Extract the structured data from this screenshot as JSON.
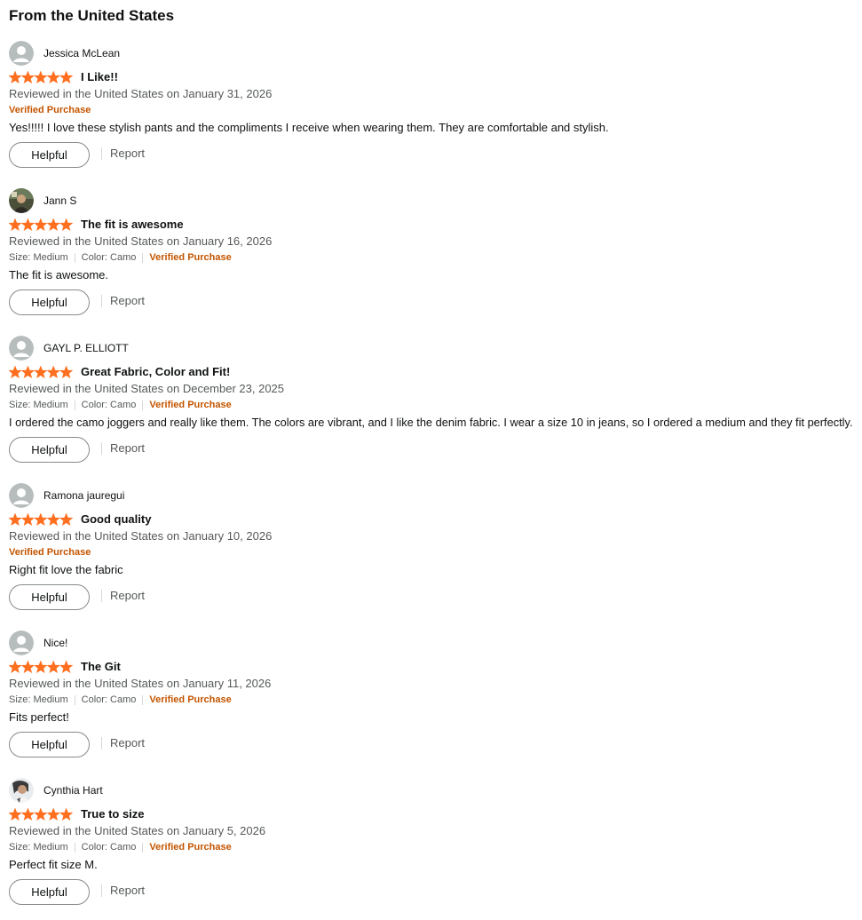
{
  "section": {
    "title": "From the United States"
  },
  "colors": {
    "star": "#ff6f1f",
    "verified": "#c45500",
    "muted": "#565959",
    "text": "#0f1111"
  },
  "reviews": [
    {
      "reviewer": "Jessica McLean",
      "avatar": "default-avatar-icon",
      "rating": 5,
      "title": "I Like!!",
      "date": "Reviewed in the United States on January 31, 2026",
      "size": "",
      "color": "",
      "verified": "Verified Purchase",
      "body": "Yes!!!!! I love these stylish pants and the compliments I receive when wearing them. They are comfortable and stylish.",
      "helpful_label": "Helpful",
      "report_label": "Report"
    },
    {
      "reviewer": "Jann S",
      "avatar": "user-photo-avatar",
      "rating": 5,
      "title": "The fit is awesome",
      "date": "Reviewed in the United States on January 16, 2026",
      "size": "Size: Medium",
      "color": "Color: Camo",
      "verified": "Verified Purchase",
      "body": "The fit is awesome.",
      "helpful_label": "Helpful",
      "report_label": "Report"
    },
    {
      "reviewer": "GAYL P. ELLIOTT",
      "avatar": "default-avatar-icon",
      "rating": 5,
      "title": "Great Fabric, Color and Fit!",
      "date": "Reviewed in the United States on December 23, 2025",
      "size": "Size: Medium",
      "color": "Color: Camo",
      "verified": "Verified Purchase",
      "body": "I ordered the camo joggers and really like them. The colors are vibrant, and I like the denim fabric. I wear a size 10 in jeans, so I ordered a medium and they fit perfectly.",
      "helpful_label": "Helpful",
      "report_label": "Report"
    },
    {
      "reviewer": "Ramona jauregui",
      "avatar": "default-avatar-icon",
      "rating": 5,
      "title": "Good quality",
      "date": "Reviewed in the United States on January 10, 2026",
      "size": "",
      "color": "",
      "verified": "Verified Purchase",
      "body": "Right fit love the fabric",
      "helpful_label": "Helpful",
      "report_label": "Report"
    },
    {
      "reviewer": "Nice!",
      "avatar": "default-avatar-icon",
      "rating": 5,
      "title": "The Git",
      "date": "Reviewed in the United States on January 11, 2026",
      "size": "Size: Medium",
      "color": "Color: Camo",
      "verified": "Verified Purchase",
      "body": "Fits perfect!",
      "helpful_label": "Helpful",
      "report_label": "Report"
    },
    {
      "reviewer": "Cynthia Hart",
      "avatar": "user-photo-avatar",
      "rating": 5,
      "title": "True to size",
      "date": "Reviewed in the United States on January 5, 2026",
      "size": "Size: Medium",
      "color": "Color: Camo",
      "verified": "Verified Purchase",
      "body": "Perfect fit size M.",
      "helpful_label": "Helpful",
      "report_label": "Report"
    }
  ]
}
